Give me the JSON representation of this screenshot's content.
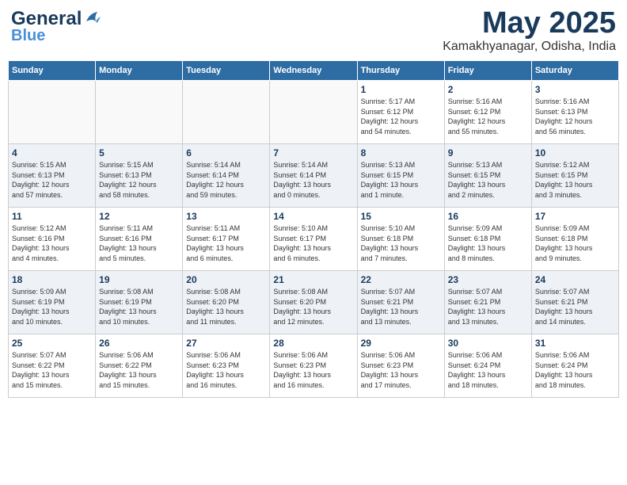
{
  "header": {
    "logo_line1": "General",
    "logo_line2": "Blue",
    "month": "May 2025",
    "location": "Kamakhyanagar, Odisha, India"
  },
  "weekdays": [
    "Sunday",
    "Monday",
    "Tuesday",
    "Wednesday",
    "Thursday",
    "Friday",
    "Saturday"
  ],
  "weeks": [
    [
      {
        "day": "",
        "info": ""
      },
      {
        "day": "",
        "info": ""
      },
      {
        "day": "",
        "info": ""
      },
      {
        "day": "",
        "info": ""
      },
      {
        "day": "1",
        "info": "Sunrise: 5:17 AM\nSunset: 6:12 PM\nDaylight: 12 hours\nand 54 minutes."
      },
      {
        "day": "2",
        "info": "Sunrise: 5:16 AM\nSunset: 6:12 PM\nDaylight: 12 hours\nand 55 minutes."
      },
      {
        "day": "3",
        "info": "Sunrise: 5:16 AM\nSunset: 6:13 PM\nDaylight: 12 hours\nand 56 minutes."
      }
    ],
    [
      {
        "day": "4",
        "info": "Sunrise: 5:15 AM\nSunset: 6:13 PM\nDaylight: 12 hours\nand 57 minutes."
      },
      {
        "day": "5",
        "info": "Sunrise: 5:15 AM\nSunset: 6:13 PM\nDaylight: 12 hours\nand 58 minutes."
      },
      {
        "day": "6",
        "info": "Sunrise: 5:14 AM\nSunset: 6:14 PM\nDaylight: 12 hours\nand 59 minutes."
      },
      {
        "day": "7",
        "info": "Sunrise: 5:14 AM\nSunset: 6:14 PM\nDaylight: 13 hours\nand 0 minutes."
      },
      {
        "day": "8",
        "info": "Sunrise: 5:13 AM\nSunset: 6:15 PM\nDaylight: 13 hours\nand 1 minute."
      },
      {
        "day": "9",
        "info": "Sunrise: 5:13 AM\nSunset: 6:15 PM\nDaylight: 13 hours\nand 2 minutes."
      },
      {
        "day": "10",
        "info": "Sunrise: 5:12 AM\nSunset: 6:15 PM\nDaylight: 13 hours\nand 3 minutes."
      }
    ],
    [
      {
        "day": "11",
        "info": "Sunrise: 5:12 AM\nSunset: 6:16 PM\nDaylight: 13 hours\nand 4 minutes."
      },
      {
        "day": "12",
        "info": "Sunrise: 5:11 AM\nSunset: 6:16 PM\nDaylight: 13 hours\nand 5 minutes."
      },
      {
        "day": "13",
        "info": "Sunrise: 5:11 AM\nSunset: 6:17 PM\nDaylight: 13 hours\nand 6 minutes."
      },
      {
        "day": "14",
        "info": "Sunrise: 5:10 AM\nSunset: 6:17 PM\nDaylight: 13 hours\nand 6 minutes."
      },
      {
        "day": "15",
        "info": "Sunrise: 5:10 AM\nSunset: 6:18 PM\nDaylight: 13 hours\nand 7 minutes."
      },
      {
        "day": "16",
        "info": "Sunrise: 5:09 AM\nSunset: 6:18 PM\nDaylight: 13 hours\nand 8 minutes."
      },
      {
        "day": "17",
        "info": "Sunrise: 5:09 AM\nSunset: 6:18 PM\nDaylight: 13 hours\nand 9 minutes."
      }
    ],
    [
      {
        "day": "18",
        "info": "Sunrise: 5:09 AM\nSunset: 6:19 PM\nDaylight: 13 hours\nand 10 minutes."
      },
      {
        "day": "19",
        "info": "Sunrise: 5:08 AM\nSunset: 6:19 PM\nDaylight: 13 hours\nand 10 minutes."
      },
      {
        "day": "20",
        "info": "Sunrise: 5:08 AM\nSunset: 6:20 PM\nDaylight: 13 hours\nand 11 minutes."
      },
      {
        "day": "21",
        "info": "Sunrise: 5:08 AM\nSunset: 6:20 PM\nDaylight: 13 hours\nand 12 minutes."
      },
      {
        "day": "22",
        "info": "Sunrise: 5:07 AM\nSunset: 6:21 PM\nDaylight: 13 hours\nand 13 minutes."
      },
      {
        "day": "23",
        "info": "Sunrise: 5:07 AM\nSunset: 6:21 PM\nDaylight: 13 hours\nand 13 minutes."
      },
      {
        "day": "24",
        "info": "Sunrise: 5:07 AM\nSunset: 6:21 PM\nDaylight: 13 hours\nand 14 minutes."
      }
    ],
    [
      {
        "day": "25",
        "info": "Sunrise: 5:07 AM\nSunset: 6:22 PM\nDaylight: 13 hours\nand 15 minutes."
      },
      {
        "day": "26",
        "info": "Sunrise: 5:06 AM\nSunset: 6:22 PM\nDaylight: 13 hours\nand 15 minutes."
      },
      {
        "day": "27",
        "info": "Sunrise: 5:06 AM\nSunset: 6:23 PM\nDaylight: 13 hours\nand 16 minutes."
      },
      {
        "day": "28",
        "info": "Sunrise: 5:06 AM\nSunset: 6:23 PM\nDaylight: 13 hours\nand 16 minutes."
      },
      {
        "day": "29",
        "info": "Sunrise: 5:06 AM\nSunset: 6:23 PM\nDaylight: 13 hours\nand 17 minutes."
      },
      {
        "day": "30",
        "info": "Sunrise: 5:06 AM\nSunset: 6:24 PM\nDaylight: 13 hours\nand 18 minutes."
      },
      {
        "day": "31",
        "info": "Sunrise: 5:06 AM\nSunset: 6:24 PM\nDaylight: 13 hours\nand 18 minutes."
      }
    ]
  ]
}
